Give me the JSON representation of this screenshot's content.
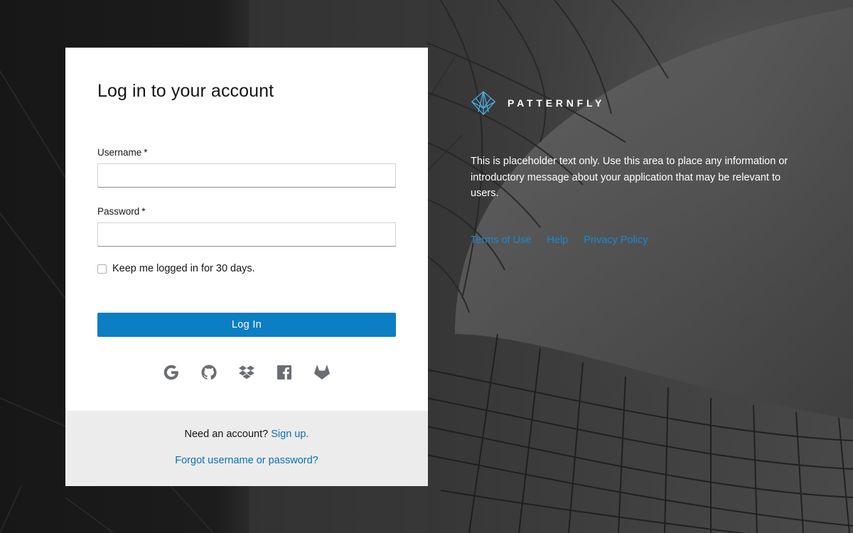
{
  "login": {
    "title": "Log in to your account",
    "username_label": "Username",
    "password_label": "Password",
    "required_marker": "*",
    "username_value": "",
    "password_value": "",
    "remember_label": "Keep me logged in for 30 days.",
    "remember_checked": false,
    "login_button": "Log In",
    "social": [
      "google-icon",
      "github-icon",
      "dropbox-icon",
      "facebook-icon",
      "gitlab-icon"
    ]
  },
  "footer": {
    "need_account": "Need an account?",
    "signup": "Sign up.",
    "forgot": "Forgot username or password?"
  },
  "brand": {
    "name": "PATTERNFLY",
    "intro": "This is placeholder text only. Use this area to place any information or introductory message about your application that may be relevant to users.",
    "links": [
      "Terms of Use",
      "Help",
      "Privacy Policy"
    ]
  },
  "colors": {
    "primary": "#0b7ec4",
    "link": "#0a6fb5",
    "footer_link": "#1b87d1",
    "logo_accent": "#4ab0e4"
  }
}
